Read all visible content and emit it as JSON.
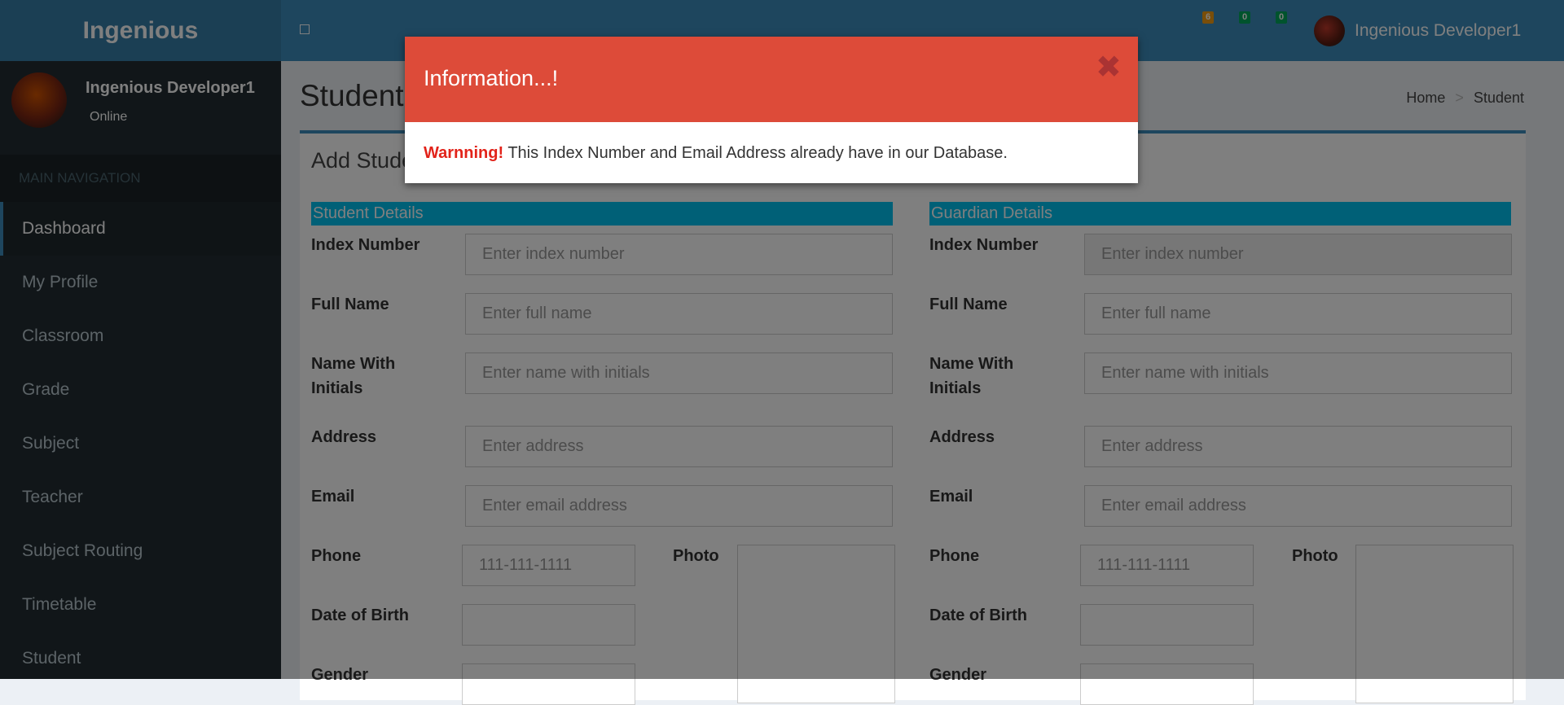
{
  "app": {
    "logo": "Ingenious",
    "user_name": "Ingenious Developer1",
    "status": "Online"
  },
  "header": {
    "badges": [
      {
        "count": "6",
        "color": "#f39c12"
      },
      {
        "count": "0",
        "color": "#00a65a"
      },
      {
        "count": "0",
        "color": "#00a65a"
      }
    ]
  },
  "sidebar": {
    "header": "MAIN NAVIGATION",
    "items": [
      {
        "label": "Dashboard"
      },
      {
        "label": "My Profile"
      },
      {
        "label": "Classroom"
      },
      {
        "label": "Grade"
      },
      {
        "label": "Subject"
      },
      {
        "label": "Teacher"
      },
      {
        "label": "Subject Routing"
      },
      {
        "label": "Timetable"
      },
      {
        "label": "Student"
      }
    ]
  },
  "page": {
    "title": "Student",
    "breadcrumb": {
      "home": "Home",
      "sep": ">",
      "current": "Student"
    },
    "box_title": "Add Student"
  },
  "student": {
    "heading": "Student Details",
    "index_label": "Index Number",
    "index_ph": "Enter index number",
    "fullname_label": "Full Name",
    "fullname_ph": "Enter full name",
    "initials_label": "Name With Initials",
    "initials_ph": "Enter name with initials",
    "address_label": "Address",
    "address_ph": "Enter address",
    "email_label": "Email",
    "email_ph": "Enter email address",
    "phone_label": "Phone",
    "phone_ph": "111-111-1111",
    "photo_label": "Photo",
    "dob_label": "Date of Birth",
    "gender_label": "Gender"
  },
  "guardian": {
    "heading": "Guardian Details",
    "index_label": "Index Number",
    "index_ph": "Enter index number",
    "fullname_label": "Full Name",
    "fullname_ph": "Enter full name",
    "initials_label": "Name With Initials",
    "initials_ph": "Enter name with initials",
    "address_label": "Address",
    "address_ph": "Enter address",
    "email_label": "Email",
    "email_ph": "Enter email address",
    "phone_label": "Phone",
    "phone_ph": "111-111-1111",
    "photo_label": "Photo",
    "dob_label": "Date of Birth",
    "gender_label": "Gender"
  },
  "modal": {
    "title": "Information...!",
    "close": "✖",
    "warning": "Warnning!",
    "message": " This Index Number and Email Address already have in our Database."
  }
}
